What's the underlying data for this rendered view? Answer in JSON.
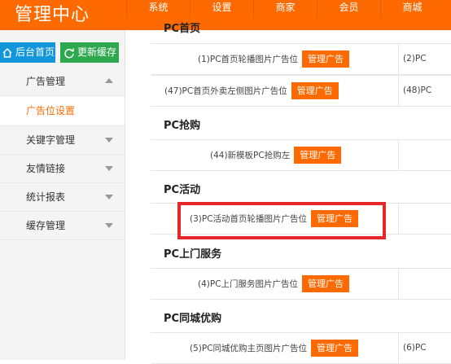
{
  "header": {
    "brand": "管理中心",
    "nav": [
      "系统",
      "设置",
      "商家",
      "会员",
      "商城"
    ]
  },
  "sidebar": {
    "home_button": "后台首页",
    "refresh_button": "更新缓存",
    "items": [
      {
        "label": "广告管理",
        "expanded": true
      },
      {
        "label": "广告位设置",
        "active": true
      },
      {
        "label": "关键字管理"
      },
      {
        "label": "友情链接"
      },
      {
        "label": "统计报表"
      },
      {
        "label": "缓存管理"
      }
    ]
  },
  "content": {
    "sections": [
      {
        "title": "PC首页",
        "rows": [
          {
            "text": "(1)PC首页轮播图片广告位",
            "button": "管理广告",
            "right_text": "(2)PC"
          },
          {
            "text": "(47)PC首页外卖左侧图片广告位",
            "button": "管理广告",
            "right_text": "(48)PC"
          }
        ]
      },
      {
        "title": "PC抢购",
        "rows": [
          {
            "text": "(44)新模板PC抢购左",
            "button": "管理广告",
            "right_text": ""
          }
        ]
      },
      {
        "title": "PC活动",
        "rows": [
          {
            "text": "(3)PC活动首页轮播图片广告位",
            "button": "管理广告",
            "right_text": "",
            "highlighted": true
          }
        ]
      },
      {
        "title": "PC上门服务",
        "rows": [
          {
            "text": "(4)PC上门服务图片广告位",
            "button": "管理广告",
            "right_text": ""
          }
        ]
      },
      {
        "title": "PC同城优购",
        "rows": [
          {
            "text": "(5)PC同城优购主页图片广告位",
            "button": "管理广告",
            "right_text": "(6)PC"
          }
        ]
      }
    ]
  },
  "colors": {
    "accent": "#ff6a00",
    "home_button": "#1296db",
    "refresh_button": "#2ea84f",
    "highlight_box": "#e4282c"
  }
}
